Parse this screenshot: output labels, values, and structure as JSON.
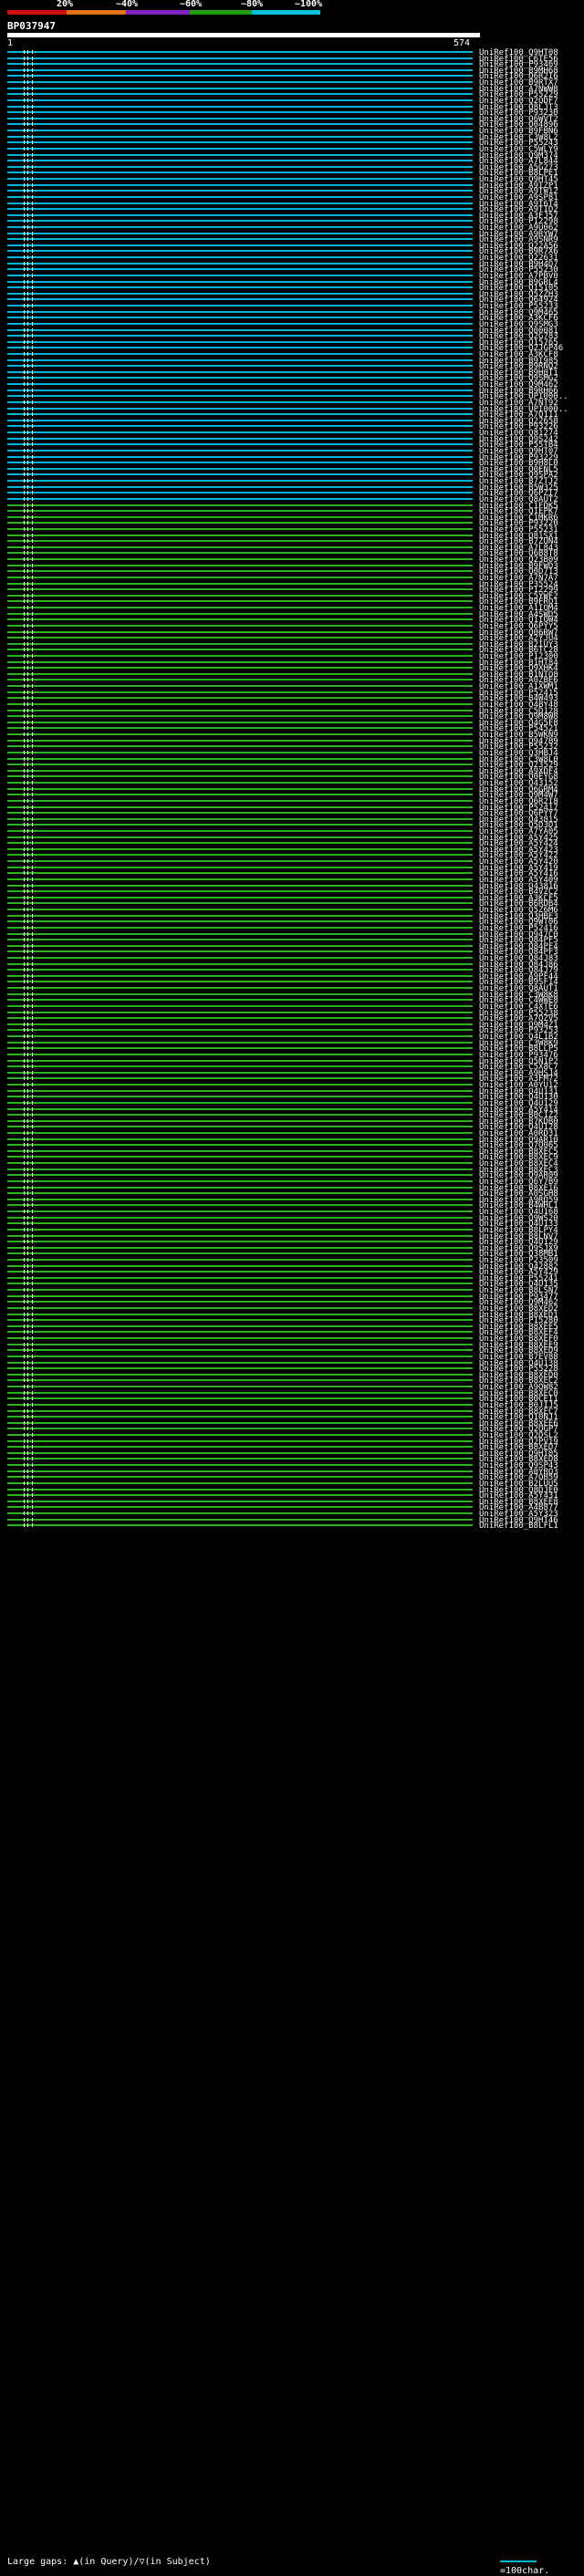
{
  "legend": {
    "percent_labels": [
      "20%",
      "~40%",
      "~60%",
      "~80%",
      "~100%"
    ],
    "colors": [
      "#d01010",
      "#e07010",
      "#8020c0",
      "#20a010",
      "#00c0e0"
    ]
  },
  "query": {
    "id": "BP037947",
    "start": "1",
    "end": "574"
  },
  "hits": [
    {
      "label": "UniRef100_Q9HT08",
      "color": "cyan"
    },
    {
      "label": "UniRef100_C6TE56",
      "color": "cyan"
    },
    {
      "label": "UniRef100_P93469",
      "color": "cyan"
    },
    {
      "label": "UniRef100_B9MH68",
      "color": "cyan"
    },
    {
      "label": "UniRef100_Q6R2I6",
      "color": "cyan"
    },
    {
      "label": "UniRef100_B9RTX7",
      "color": "cyan"
    },
    {
      "label": "UniRef100_A7NWW8",
      "color": "cyan"
    },
    {
      "label": "UniRef100_P55229",
      "color": "cyan"
    },
    {
      "label": "UniRef100_Q2QDF7",
      "color": "cyan"
    },
    {
      "label": "UniRef100_Q8LJT3",
      "color": "cyan"
    },
    {
      "label": "UniRef100_P93230",
      "color": "cyan"
    },
    {
      "label": "UniRef100_Q6WVT2",
      "color": "cyan"
    },
    {
      "label": "UniRef100_O04896",
      "color": "cyan"
    },
    {
      "label": "UniRef100_B9FBN6",
      "color": "cyan"
    },
    {
      "label": "UniRef100_C3W8L2",
      "color": "cyan"
    },
    {
      "label": "UniRef100_P55243",
      "color": "cyan"
    },
    {
      "label": "UniRef100_C5WLY9",
      "color": "cyan"
    },
    {
      "label": "UniRef100_Q9M374",
      "color": "cyan"
    },
    {
      "label": "UniRef100_A7L844",
      "color": "cyan"
    },
    {
      "label": "UniRef100_A5G273",
      "color": "cyan"
    },
    {
      "label": "UniRef100_B8LPE1",
      "color": "cyan"
    },
    {
      "label": "UniRef100_Q9HT45",
      "color": "cyan"
    },
    {
      "label": "UniRef100_A9TZP1",
      "color": "cyan"
    },
    {
      "label": "UniRef100_A9TW12",
      "color": "cyan"
    },
    {
      "label": "UniRef100_A9SP81",
      "color": "cyan"
    },
    {
      "label": "UniRef100_A9T6T4",
      "color": "cyan"
    },
    {
      "label": "UniRef100_A9TID2",
      "color": "cyan"
    },
    {
      "label": "UniRef100_A3FJ57",
      "color": "cyan"
    },
    {
      "label": "UniRef100_P12298",
      "color": "cyan"
    },
    {
      "label": "UniRef100_A9U062",
      "color": "cyan"
    },
    {
      "label": "UniRef100_A9RYW7",
      "color": "cyan"
    },
    {
      "label": "UniRef100_A9SNR9",
      "color": "cyan"
    },
    {
      "label": "UniRef100_Q22A56",
      "color": "cyan"
    },
    {
      "label": "UniRef100_B9R7X6",
      "color": "cyan"
    },
    {
      "label": "UniRef100_Q22631",
      "color": "cyan"
    },
    {
      "label": "UniRef100_B9H4D7",
      "color": "cyan"
    },
    {
      "label": "UniRef100_P55230",
      "color": "cyan"
    },
    {
      "label": "UniRef100_A7PBV0",
      "color": "cyan"
    },
    {
      "label": "UniRef100_B9GRL4",
      "color": "cyan"
    },
    {
      "label": "UniRef100_Q15105",
      "color": "cyan"
    },
    {
      "label": "UniRef100_Q5ZZH3",
      "color": "cyan"
    },
    {
      "label": "UniRef100_Q64924",
      "color": "cyan"
    },
    {
      "label": "UniRef100_P55233",
      "color": "cyan"
    },
    {
      "label": "UniRef100_Q9M465",
      "color": "cyan"
    },
    {
      "label": "UniRef100_A3KCF6",
      "color": "cyan"
    },
    {
      "label": "UniRef100_Q9SMG3",
      "color": "cyan"
    },
    {
      "label": "UniRef100_Q00081",
      "color": "cyan"
    },
    {
      "label": "UniRef100_Q2G783",
      "color": "cyan"
    },
    {
      "label": "UniRef100_Q15765",
      "color": "cyan"
    },
    {
      "label": "UniRef100_Q2JGP46",
      "color": "cyan"
    },
    {
      "label": "UniRef100_A3KCF8",
      "color": "cyan"
    },
    {
      "label": "UniRef100_B9I985",
      "color": "cyan"
    },
    {
      "label": "UniRef100_B9RNQ2",
      "color": "cyan"
    },
    {
      "label": "UniRef100_B9H0T1",
      "color": "cyan"
    },
    {
      "label": "UniRef100_Q9SMG2",
      "color": "cyan"
    },
    {
      "label": "UniRef100_Q9M462",
      "color": "cyan"
    },
    {
      "label": "UniRef100_B9RH66",
      "color": "cyan"
    },
    {
      "label": "UniRef100_UPI000..",
      "color": "cyan"
    },
    {
      "label": "UniRef100_A7NT92",
      "color": "cyan"
    },
    {
      "label": "UniRef100_UPI000..",
      "color": "cyan"
    },
    {
      "label": "UniRef100_A7Q111",
      "color": "cyan"
    },
    {
      "label": "UniRef100_Q22658",
      "color": "cyan"
    },
    {
      "label": "UniRef100_P93226",
      "color": "cyan"
    },
    {
      "label": "UniRef100_Q81274",
      "color": "cyan"
    },
    {
      "label": "UniRef100_Q9S242",
      "color": "cyan"
    },
    {
      "label": "UniRef100_P55TB4",
      "color": "cyan"
    },
    {
      "label": "UniRef100_Q9HT07",
      "color": "cyan"
    },
    {
      "label": "UniRef100_P93229",
      "color": "cyan"
    },
    {
      "label": "UniRef100_B9H8L0",
      "color": "cyan"
    },
    {
      "label": "UniRef100_Q0ENL5",
      "color": "cyan"
    },
    {
      "label": "UniRef100_Q9SPA2",
      "color": "cyan"
    },
    {
      "label": "UniRef100_B7ZTJ2",
      "color": "cyan"
    },
    {
      "label": "UniRef100_B5W325",
      "color": "cyan"
    },
    {
      "label": "UniRef100_Q6PZI7",
      "color": "cyan"
    },
    {
      "label": "UniRef100_Q8AUT2",
      "color": "cyan"
    },
    {
      "label": "UniRef100_C1FDK5",
      "color": "green"
    },
    {
      "label": "UniRef100_Q1EPK7",
      "color": "green"
    },
    {
      "label": "UniRef100_C1MKR6",
      "color": "green"
    },
    {
      "label": "UniRef100_P93220",
      "color": "green"
    },
    {
      "label": "UniRef100_P55231",
      "color": "green"
    },
    {
      "label": "UniRef100_Q81SX1",
      "color": "green"
    },
    {
      "label": "UniRef100_B7ZUN4",
      "color": "green"
    },
    {
      "label": "UniRef100_A7L843",
      "color": "green"
    },
    {
      "label": "UniRef100_Q6B8T8",
      "color": "green"
    },
    {
      "label": "UniRef100_Q23B09",
      "color": "green"
    },
    {
      "label": "UniRef100_B9FWD3",
      "color": "green"
    },
    {
      "label": "UniRef100_Q0D713",
      "color": "green"
    },
    {
      "label": "UniRef100_A7N7A7",
      "color": "green"
    },
    {
      "label": "UniRef100_P35524",
      "color": "green"
    },
    {
      "label": "UniRef100_P12299",
      "color": "green"
    },
    {
      "label": "UniRef100_C5YWF2",
      "color": "green"
    },
    {
      "label": "UniRef100_B9FRQ1",
      "color": "green"
    },
    {
      "label": "UniRef100_A1IQM4",
      "color": "green"
    },
    {
      "label": "UniRef100_A4SWD5",
      "color": "green"
    },
    {
      "label": "UniRef100_Q1IQW4",
      "color": "green"
    },
    {
      "label": "UniRef100_Q6PYY5",
      "color": "green"
    },
    {
      "label": "UniRef100_Q06RW7",
      "color": "green"
    },
    {
      "label": "UniRef100_A2YJU4",
      "color": "green"
    },
    {
      "label": "UniRef100_B2IUY3",
      "color": "green"
    },
    {
      "label": "UniRef100_B6TC28",
      "color": "green"
    },
    {
      "label": "UniRef100_P12300",
      "color": "green"
    },
    {
      "label": "UniRef100_B1HT84",
      "color": "green"
    },
    {
      "label": "UniRef100_Q9XHK4",
      "color": "green"
    },
    {
      "label": "UniRef100_B1NTO8",
      "color": "green"
    },
    {
      "label": "UniRef100_A0ZBE6",
      "color": "green"
    },
    {
      "label": "UniRef100_A1XWM1",
      "color": "green"
    },
    {
      "label": "UniRef100_P52415",
      "color": "green"
    },
    {
      "label": "UniRef100_B4W493",
      "color": "green"
    },
    {
      "label": "UniRef100_O4BY48",
      "color": "green"
    },
    {
      "label": "UniRef100_C5D128",
      "color": "green"
    },
    {
      "label": "UniRef100_Q9M8W8",
      "color": "green"
    },
    {
      "label": "UniRef100_Q4G5F8",
      "color": "green"
    },
    {
      "label": "UniRef100_P54521",
      "color": "green"
    },
    {
      "label": "UniRef100_B5WKN9",
      "color": "green"
    },
    {
      "label": "UniRef100_Q947B9",
      "color": "green"
    },
    {
      "label": "UniRef100_P55232",
      "color": "green"
    },
    {
      "label": "UniRef100_Q3HBJ4",
      "color": "green"
    },
    {
      "label": "UniRef100_C3W8L0",
      "color": "green"
    },
    {
      "label": "UniRef100_Q23529",
      "color": "green"
    },
    {
      "label": "UniRef100_A9XDF4",
      "color": "green"
    },
    {
      "label": "UniRef100_Q0EYG8",
      "color": "green"
    },
    {
      "label": "UniRef100_Q43152",
      "color": "green"
    },
    {
      "label": "UniRef100_Q6GRM4",
      "color": "green"
    },
    {
      "label": "UniRef100_Q9M4W7",
      "color": "green"
    },
    {
      "label": "UniRef100_Q6R2I8",
      "color": "green"
    },
    {
      "label": "UniRef100_P52417",
      "color": "green"
    },
    {
      "label": "UniRef100_Q6PYY7",
      "color": "green"
    },
    {
      "label": "UniRef100_Q43815",
      "color": "green"
    },
    {
      "label": "UniRef100_Q5D3D1",
      "color": "green"
    },
    {
      "label": "UniRef100_A7YA05",
      "color": "green"
    },
    {
      "label": "UniRef100_A5Y425",
      "color": "green"
    },
    {
      "label": "UniRef100_A5Y424",
      "color": "green"
    },
    {
      "label": "UniRef100_A5Y423",
      "color": "green"
    },
    {
      "label": "UniRef100_A5Y422",
      "color": "green"
    },
    {
      "label": "UniRef100_A5Y420",
      "color": "green"
    },
    {
      "label": "UniRef100_A5Y419",
      "color": "green"
    },
    {
      "label": "UniRef100_A5Y416",
      "color": "green"
    },
    {
      "label": "UniRef100_A5Y409",
      "color": "green"
    },
    {
      "label": "UniRef100_Q43816",
      "color": "green"
    },
    {
      "label": "UniRef100_B4VZC2",
      "color": "green"
    },
    {
      "label": "UniRef100_A3KCF5",
      "color": "green"
    },
    {
      "label": "UniRef100_B6RDB4",
      "color": "green"
    },
    {
      "label": "UniRef100_Q5Z6M6",
      "color": "green"
    },
    {
      "label": "UniRef100_Q3HBE3",
      "color": "green"
    },
    {
      "label": "UniRef100_Q9WT06",
      "color": "green"
    },
    {
      "label": "UniRef100_P52416",
      "color": "green"
    },
    {
      "label": "UniRef100_Q947C0",
      "color": "green"
    },
    {
      "label": "UniRef100_Q84PF5",
      "color": "green"
    },
    {
      "label": "UniRef100_Q84PF4",
      "color": "green"
    },
    {
      "label": "UniRef100_Q84PF3",
      "color": "green"
    },
    {
      "label": "UniRef100_Q84J83",
      "color": "green"
    },
    {
      "label": "UniRef100_Q84J86",
      "color": "green"
    },
    {
      "label": "UniRef100_Q84J79",
      "color": "green"
    },
    {
      "label": "UniRef100_A9PF44",
      "color": "green"
    },
    {
      "label": "UniRef100_B9SF14",
      "color": "green"
    },
    {
      "label": "UniRef100_Q8AUT1",
      "color": "green"
    },
    {
      "label": "UniRef100_C3W8K8",
      "color": "green"
    },
    {
      "label": "UniRef100_C4WWE8",
      "color": "green"
    },
    {
      "label": "UniRef100_C4XTE6",
      "color": "green"
    },
    {
      "label": "UniRef100_P55238",
      "color": "green"
    },
    {
      "label": "UniRef100_A7QZV5",
      "color": "green"
    },
    {
      "label": "UniRef100_Q9M4Z1",
      "color": "green"
    },
    {
      "label": "UniRef100_P93253",
      "color": "green"
    },
    {
      "label": "UniRef100_Q4L1B2",
      "color": "green"
    },
    {
      "label": "UniRef100_C3W8K9",
      "color": "green"
    },
    {
      "label": "UniRef100_B8LLP5",
      "color": "green"
    },
    {
      "label": "UniRef100_P93476",
      "color": "green"
    },
    {
      "label": "UniRef100_Q5N1P2",
      "color": "green"
    },
    {
      "label": "UniRef100_C5X8C7",
      "color": "green"
    },
    {
      "label": "UniRef100_A9HSJ4",
      "color": "green"
    },
    {
      "label": "UniRef100_A3FM72",
      "color": "green"
    },
    {
      "label": "UniRef100_A0YU12",
      "color": "green"
    },
    {
      "label": "UniRef100_Q4U131",
      "color": "green"
    },
    {
      "label": "UniRef100_Q4U130",
      "color": "green"
    },
    {
      "label": "UniRef100_Q4U129",
      "color": "green"
    },
    {
      "label": "UniRef100_A5Y414",
      "color": "green"
    },
    {
      "label": "UniRef100_B0C1Z2",
      "color": "green"
    },
    {
      "label": "UniRef100_B7KDB0",
      "color": "green"
    },
    {
      "label": "UniRef100_Q4U128",
      "color": "green"
    },
    {
      "label": "UniRef100_A0RD31",
      "color": "green"
    },
    {
      "label": "UniRef100_Q9AR10",
      "color": "green"
    },
    {
      "label": "UniRef100_Q7Q065",
      "color": "green"
    },
    {
      "label": "UniRef100_B8XEC5",
      "color": "green"
    },
    {
      "label": "UniRef100_B8XEC9",
      "color": "green"
    },
    {
      "label": "UniRef100_B8XEC4",
      "color": "green"
    },
    {
      "label": "UniRef100_B8XEC3",
      "color": "green"
    },
    {
      "label": "UniRef100_Q9AR09",
      "color": "green"
    },
    {
      "label": "UniRef100_Q6Y7B9",
      "color": "green"
    },
    {
      "label": "UniRef100_B8XE16",
      "color": "green"
    },
    {
      "label": "UniRef100_A0SGH8",
      "color": "green"
    },
    {
      "label": "UniRef100_A9RD59",
      "color": "green"
    },
    {
      "label": "UniRef100_B4WHL1",
      "color": "green"
    },
    {
      "label": "UniRef100_Q4U168",
      "color": "green"
    },
    {
      "label": "UniRef100_Q9WS20",
      "color": "green"
    },
    {
      "label": "UniRef100_Q4U133",
      "color": "green"
    },
    {
      "label": "UniRef100_B8LPY4",
      "color": "green"
    },
    {
      "label": "UniRef100_B8LNV7",
      "color": "green"
    },
    {
      "label": "UniRef100_Q4U129",
      "color": "green"
    },
    {
      "label": "UniRef100_Q9SJX9",
      "color": "green"
    },
    {
      "label": "UniRef100_Q38MB1",
      "color": "green"
    },
    {
      "label": "UniRef100_P23509",
      "color": "green"
    },
    {
      "label": "UniRef100_Q42882",
      "color": "green"
    },
    {
      "label": "UniRef100_A5Y429",
      "color": "green"
    },
    {
      "label": "UniRef100_P55241",
      "color": "green"
    },
    {
      "label": "UniRef100_Q4U135",
      "color": "green"
    },
    {
      "label": "UniRef100_B8LSN7",
      "color": "green"
    },
    {
      "label": "UniRef100_P93477",
      "color": "green"
    },
    {
      "label": "UniRef100_Q9M462",
      "color": "green"
    },
    {
      "label": "UniRef100_B8XED2",
      "color": "green"
    },
    {
      "label": "UniRef100_B8XED1",
      "color": "green"
    },
    {
      "label": "UniRef100_P15280",
      "color": "green"
    },
    {
      "label": "UniRef100_B8XEE5",
      "color": "green"
    },
    {
      "label": "UniRef100_B8XEF4",
      "color": "green"
    },
    {
      "label": "UniRef100_B8XEF0",
      "color": "green"
    },
    {
      "label": "UniRef100_B8XEE9",
      "color": "green"
    },
    {
      "label": "UniRef100_B8XED9",
      "color": "green"
    },
    {
      "label": "UniRef100_B7EV88",
      "color": "green"
    },
    {
      "label": "UniRef100_Q4U138",
      "color": "green"
    },
    {
      "label": "UniRef100_P55228",
      "color": "green"
    },
    {
      "label": "UniRef100_B8XED0",
      "color": "green"
    },
    {
      "label": "UniRef100_B8XEC2",
      "color": "green"
    },
    {
      "label": "UniRef100_A9QW82",
      "color": "green"
    },
    {
      "label": "UniRef100_B8XEC0",
      "color": "green"
    },
    {
      "label": "UniRef100_B0CEI1",
      "color": "green"
    },
    {
      "label": "UniRef100_B0JIJ5",
      "color": "green"
    },
    {
      "label": "UniRef100_B8XEC7",
      "color": "green"
    },
    {
      "label": "UniRef100_Q10NJ1",
      "color": "green"
    },
    {
      "label": "UniRef100_B8XEE6",
      "color": "green"
    },
    {
      "label": "UniRef100_Q2QGP7",
      "color": "green"
    },
    {
      "label": "UniRef100_Q2DSL2",
      "color": "green"
    },
    {
      "label": "UniRef100_Q2PV19",
      "color": "green"
    },
    {
      "label": "UniRef100_B8XED7",
      "color": "green"
    },
    {
      "label": "UniRef100_Q9HT05",
      "color": "green"
    },
    {
      "label": "UniRef100_B8XED8",
      "color": "green"
    },
    {
      "label": "UniRef100_Q9SP43",
      "color": "green"
    },
    {
      "label": "UniRef100_A0YRQ3",
      "color": "green"
    },
    {
      "label": "UniRef100_A7QB59",
      "color": "green"
    },
    {
      "label": "UniRef100_B2LUU5",
      "color": "green"
    },
    {
      "label": "UniRef100_Q8DJE0",
      "color": "green"
    },
    {
      "label": "UniRef100_A5Y431",
      "color": "green"
    },
    {
      "label": "UniRef100_B8XEE8",
      "color": "green"
    },
    {
      "label": "UniRef100_A4B877",
      "color": "green"
    },
    {
      "label": "UniRef100_A5Y323",
      "color": "green"
    },
    {
      "label": "UniRef100_Q9HT46",
      "color": "green"
    },
    {
      "label": "UniRef100_B8LFL1",
      "color": "green"
    }
  ],
  "footer": {
    "legend_text": "Large gaps: ▲(in Query)/▽(in Subject)",
    "scale_text": "=100char."
  }
}
